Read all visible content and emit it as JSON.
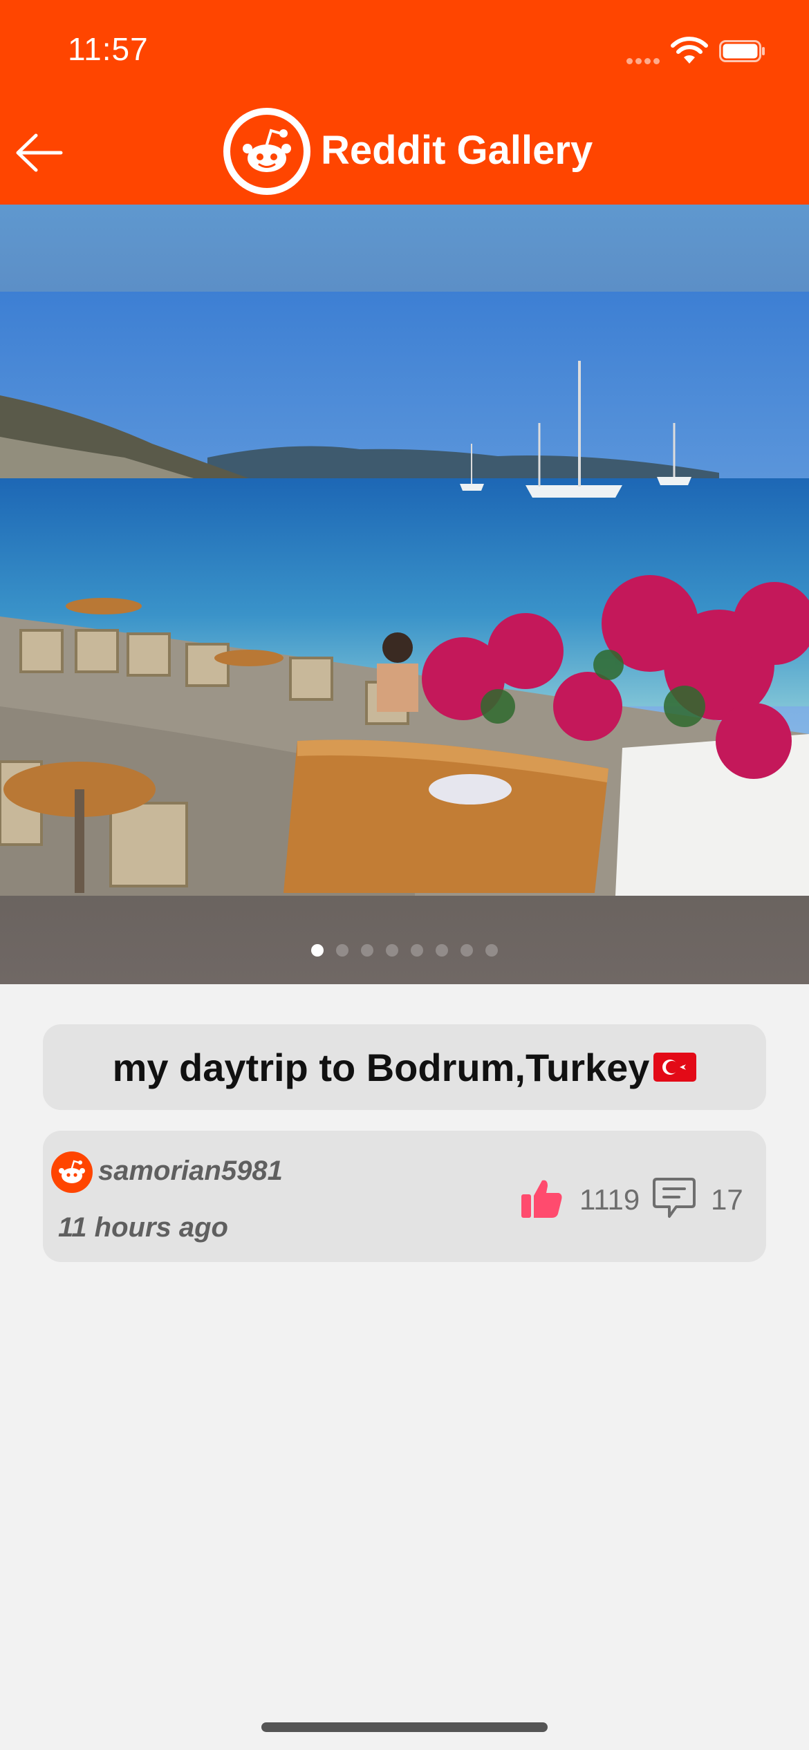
{
  "status_bar": {
    "time": "11:57"
  },
  "header": {
    "title": "Reddit Gallery"
  },
  "gallery": {
    "page_count": 8,
    "active_index": 0
  },
  "post": {
    "title": "my daytrip to Bodrum,Turkey",
    "author": "samorian5981",
    "time_ago": "11 hours ago",
    "likes": "1119",
    "comments": "17"
  },
  "colors": {
    "brand": "#ff4500",
    "card": "#e3e3e3",
    "like": "#ff4b6e"
  }
}
